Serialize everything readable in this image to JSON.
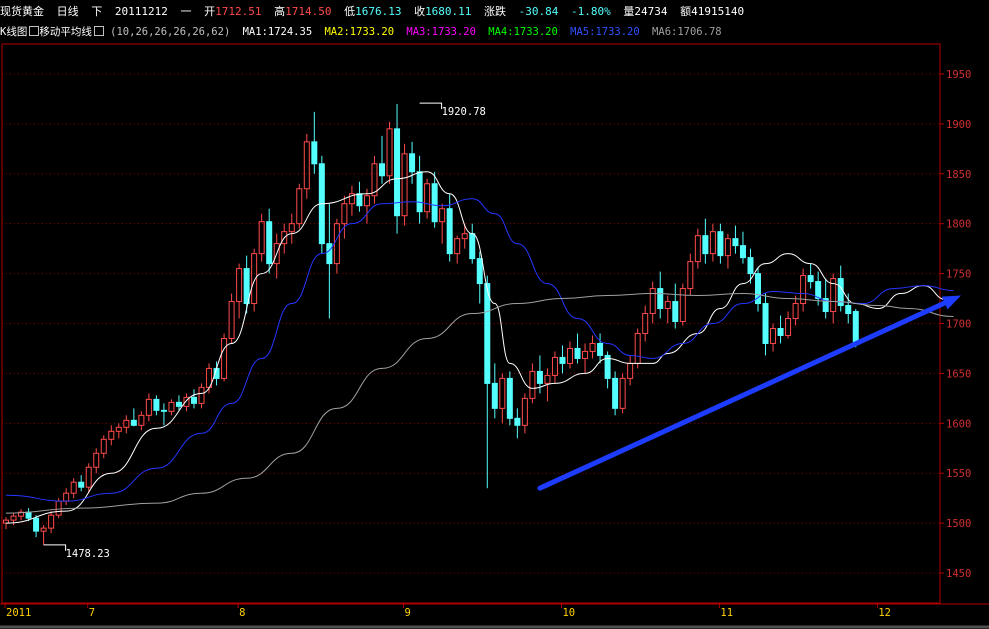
{
  "header": {
    "instrument": "现货黄金",
    "period": "日线",
    "direction": "下",
    "date": "20111212",
    "weekday": "一",
    "open_label": "开",
    "open": "1712.51",
    "high_label": "高",
    "high": "1714.50",
    "low_label": "低",
    "low": "1676.13",
    "close_label": "收",
    "close": "1680.11",
    "change_label": "涨跌",
    "change": "-30.84",
    "change_pct": "-1.80%",
    "volume_label": "量",
    "volume": "24734",
    "amount_label": "额",
    "amount": "41915140"
  },
  "indicator": {
    "kline_label": "K线图",
    "ma_label": "移动平均线",
    "params": "(10,26,26,26,26,62)",
    "ma": [
      {
        "name": "MA1",
        "value": "1724.35",
        "color": "#ffffff"
      },
      {
        "name": "MA2",
        "value": "1733.20",
        "color": "#ffff00"
      },
      {
        "name": "MA3",
        "value": "1733.20",
        "color": "#ff00ff"
      },
      {
        "name": "MA4",
        "value": "1733.20",
        "color": "#00ff00"
      },
      {
        "name": "MA5",
        "value": "1733.20",
        "color": "#3050ff"
      },
      {
        "name": "MA6",
        "value": "1706.78",
        "color": "#a0a0a0"
      }
    ]
  },
  "chart_data": {
    "type": "candlestick",
    "ylim": [
      1420,
      1980
    ],
    "yticks": [
      1450,
      1500,
      1550,
      1600,
      1650,
      1700,
      1750,
      1800,
      1850,
      1900,
      1950
    ],
    "x_labels": [
      {
        "label": "2011",
        "index": 0
      },
      {
        "label": "7",
        "index": 11
      },
      {
        "label": "8",
        "index": 31
      },
      {
        "label": "9",
        "index": 53
      },
      {
        "label": "10",
        "index": 74
      },
      {
        "label": "11",
        "index": 95
      },
      {
        "label": "12",
        "index": 116
      }
    ],
    "annotations": [
      {
        "text": "1920.78",
        "index": 55,
        "value": 1920.78
      },
      {
        "text": "1478.23",
        "index": 5,
        "value": 1478.23
      }
    ],
    "trendline": {
      "from": {
        "index": 71,
        "value": 1535
      },
      "to": {
        "index": 127,
        "value": 1728
      },
      "color": "#1e3cff"
    },
    "up_color": "#ff4a4a",
    "down_color": "#54ffff",
    "candles": [
      [
        1500,
        1506,
        1494,
        1503
      ],
      [
        1503,
        1510,
        1498,
        1507
      ],
      [
        1507,
        1514,
        1503,
        1511
      ],
      [
        1511,
        1515,
        1502,
        1505
      ],
      [
        1505,
        1508,
        1486,
        1492
      ],
      [
        1492,
        1498,
        1478,
        1495
      ],
      [
        1495,
        1512,
        1490,
        1508
      ],
      [
        1508,
        1525,
        1505,
        1522
      ],
      [
        1522,
        1535,
        1518,
        1530
      ],
      [
        1530,
        1545,
        1525,
        1541
      ],
      [
        1541,
        1548,
        1532,
        1536
      ],
      [
        1536,
        1560,
        1530,
        1556
      ],
      [
        1556,
        1575,
        1550,
        1570
      ],
      [
        1570,
        1588,
        1565,
        1584
      ],
      [
        1584,
        1598,
        1578,
        1592
      ],
      [
        1592,
        1600,
        1585,
        1596
      ],
      [
        1596,
        1608,
        1590,
        1603
      ],
      [
        1603,
        1615,
        1597,
        1598
      ],
      [
        1598,
        1612,
        1593,
        1608
      ],
      [
        1608,
        1630,
        1602,
        1624
      ],
      [
        1624,
        1628,
        1608,
        1613
      ],
      [
        1613,
        1620,
        1598,
        1612
      ],
      [
        1612,
        1624,
        1608,
        1621
      ],
      [
        1621,
        1628,
        1613,
        1617
      ],
      [
        1617,
        1630,
        1612,
        1626
      ],
      [
        1626,
        1634,
        1615,
        1620
      ],
      [
        1620,
        1640,
        1615,
        1636
      ],
      [
        1636,
        1660,
        1630,
        1655
      ],
      [
        1655,
        1662,
        1638,
        1645
      ],
      [
        1645,
        1690,
        1642,
        1685
      ],
      [
        1685,
        1730,
        1680,
        1722
      ],
      [
        1722,
        1760,
        1705,
        1755
      ],
      [
        1755,
        1768,
        1710,
        1720
      ],
      [
        1720,
        1775,
        1712,
        1770
      ],
      [
        1770,
        1810,
        1762,
        1802
      ],
      [
        1802,
        1815,
        1750,
        1760
      ],
      [
        1760,
        1790,
        1745,
        1780
      ],
      [
        1780,
        1800,
        1770,
        1792
      ],
      [
        1792,
        1810,
        1780,
        1800
      ],
      [
        1800,
        1840,
        1795,
        1835
      ],
      [
        1835,
        1890,
        1825,
        1882
      ],
      [
        1882,
        1912,
        1850,
        1860
      ],
      [
        1860,
        1868,
        1770,
        1780
      ],
      [
        1780,
        1820,
        1705,
        1760
      ],
      [
        1760,
        1805,
        1750,
        1800
      ],
      [
        1800,
        1828,
        1785,
        1820
      ],
      [
        1820,
        1838,
        1808,
        1830
      ],
      [
        1830,
        1842,
        1812,
        1818
      ],
      [
        1818,
        1835,
        1800,
        1828
      ],
      [
        1828,
        1868,
        1820,
        1860
      ],
      [
        1860,
        1888,
        1840,
        1848
      ],
      [
        1848,
        1902,
        1840,
        1895
      ],
      [
        1895,
        1920,
        1790,
        1808
      ],
      [
        1808,
        1880,
        1798,
        1870
      ],
      [
        1870,
        1882,
        1840,
        1852
      ],
      [
        1852,
        1868,
        1800,
        1812
      ],
      [
        1812,
        1845,
        1805,
        1840
      ],
      [
        1840,
        1852,
        1796,
        1802
      ],
      [
        1802,
        1820,
        1780,
        1815
      ],
      [
        1815,
        1830,
        1762,
        1770
      ],
      [
        1770,
        1788,
        1760,
        1785
      ],
      [
        1785,
        1800,
        1775,
        1790
      ],
      [
        1790,
        1800,
        1760,
        1765
      ],
      [
        1765,
        1772,
        1720,
        1740
      ],
      [
        1740,
        1748,
        1535,
        1640
      ],
      [
        1640,
        1660,
        1605,
        1615
      ],
      [
        1615,
        1650,
        1600,
        1645
      ],
      [
        1645,
        1652,
        1598,
        1605
      ],
      [
        1605,
        1615,
        1585,
        1598
      ],
      [
        1598,
        1630,
        1590,
        1625
      ],
      [
        1625,
        1660,
        1620,
        1652
      ],
      [
        1652,
        1668,
        1630,
        1640
      ],
      [
        1640,
        1655,
        1622,
        1648
      ],
      [
        1648,
        1672,
        1640,
        1666
      ],
      [
        1666,
        1678,
        1650,
        1660
      ],
      [
        1660,
        1682,
        1655,
        1675
      ],
      [
        1675,
        1690,
        1660,
        1665
      ],
      [
        1665,
        1680,
        1650,
        1672
      ],
      [
        1672,
        1688,
        1665,
        1680
      ],
      [
        1680,
        1690,
        1660,
        1668
      ],
      [
        1668,
        1672,
        1635,
        1645
      ],
      [
        1645,
        1652,
        1608,
        1615
      ],
      [
        1615,
        1650,
        1610,
        1645
      ],
      [
        1645,
        1668,
        1638,
        1660
      ],
      [
        1660,
        1695,
        1655,
        1690
      ],
      [
        1690,
        1718,
        1682,
        1710
      ],
      [
        1710,
        1742,
        1700,
        1735
      ],
      [
        1735,
        1752,
        1705,
        1715
      ],
      [
        1715,
        1728,
        1700,
        1722
      ],
      [
        1722,
        1740,
        1695,
        1702
      ],
      [
        1702,
        1740,
        1698,
        1735
      ],
      [
        1735,
        1770,
        1728,
        1762
      ],
      [
        1762,
        1795,
        1755,
        1788
      ],
      [
        1788,
        1805,
        1760,
        1770
      ],
      [
        1770,
        1800,
        1762,
        1792
      ],
      [
        1792,
        1800,
        1760,
        1768
      ],
      [
        1768,
        1790,
        1755,
        1785
      ],
      [
        1785,
        1798,
        1770,
        1778
      ],
      [
        1778,
        1792,
        1760,
        1766
      ],
      [
        1766,
        1775,
        1740,
        1750
      ],
      [
        1750,
        1756,
        1712,
        1720
      ],
      [
        1720,
        1730,
        1668,
        1680
      ],
      [
        1680,
        1700,
        1672,
        1695
      ],
      [
        1695,
        1708,
        1680,
        1688
      ],
      [
        1688,
        1712,
        1685,
        1705
      ],
      [
        1705,
        1728,
        1698,
        1720
      ],
      [
        1720,
        1755,
        1712,
        1748
      ],
      [
        1748,
        1760,
        1735,
        1742
      ],
      [
        1742,
        1752,
        1718,
        1725
      ],
      [
        1725,
        1745,
        1705,
        1712
      ],
      [
        1712,
        1750,
        1700,
        1745
      ],
      [
        1745,
        1758,
        1712,
        1718
      ],
      [
        1718,
        1730,
        1700,
        1710
      ],
      [
        1712,
        1714.5,
        1676.13,
        1680.11
      ]
    ],
    "ma_lines": [
      {
        "name": "MA1",
        "color": "#ffffff",
        "points": [
          [
            0,
            1500
          ],
          [
            8,
            1512
          ],
          [
            14,
            1550
          ],
          [
            20,
            1595
          ],
          [
            26,
            1630
          ],
          [
            30,
            1680
          ],
          [
            34,
            1750
          ],
          [
            38,
            1790
          ],
          [
            42,
            1820
          ],
          [
            48,
            1830
          ],
          [
            52,
            1845
          ],
          [
            56,
            1852
          ],
          [
            59,
            1830
          ],
          [
            62,
            1790
          ],
          [
            65,
            1720
          ],
          [
            67,
            1660
          ],
          [
            70,
            1635
          ],
          [
            73,
            1640
          ],
          [
            77,
            1650
          ],
          [
            80,
            1665
          ],
          [
            83,
            1660
          ],
          [
            86,
            1660
          ],
          [
            88,
            1670
          ],
          [
            92,
            1690
          ],
          [
            95,
            1715
          ],
          [
            98,
            1740
          ],
          [
            101,
            1760
          ],
          [
            104,
            1770
          ],
          [
            107,
            1760
          ],
          [
            110,
            1740
          ],
          [
            113,
            1720
          ],
          [
            116,
            1715
          ],
          [
            119,
            1730
          ],
          [
            122,
            1738
          ],
          [
            125,
            1724
          ]
        ]
      },
      {
        "name": "MA5",
        "color": "#2535ff",
        "points": [
          [
            0,
            1528
          ],
          [
            8,
            1522
          ],
          [
            14,
            1530
          ],
          [
            20,
            1555
          ],
          [
            26,
            1590
          ],
          [
            30,
            1620
          ],
          [
            34,
            1665
          ],
          [
            38,
            1720
          ],
          [
            42,
            1770
          ],
          [
            46,
            1800
          ],
          [
            50,
            1820
          ],
          [
            54,
            1822
          ],
          [
            58,
            1818
          ],
          [
            62,
            1825
          ],
          [
            65,
            1810
          ],
          [
            68,
            1780
          ],
          [
            72,
            1740
          ],
          [
            76,
            1705
          ],
          [
            80,
            1680
          ],
          [
            83,
            1668
          ],
          [
            86,
            1665
          ],
          [
            90,
            1680
          ],
          [
            94,
            1700
          ],
          [
            98,
            1720
          ],
          [
            102,
            1732
          ],
          [
            106,
            1730
          ],
          [
            110,
            1722
          ],
          [
            114,
            1720
          ],
          [
            118,
            1735
          ],
          [
            122,
            1738
          ],
          [
            126,
            1733
          ]
        ]
      },
      {
        "name": "MA6",
        "color": "#a0a0a0",
        "points": [
          [
            0,
            1510
          ],
          [
            10,
            1515
          ],
          [
            20,
            1520
          ],
          [
            26,
            1530
          ],
          [
            32,
            1545
          ],
          [
            38,
            1570
          ],
          [
            44,
            1615
          ],
          [
            50,
            1655
          ],
          [
            56,
            1685
          ],
          [
            62,
            1710
          ],
          [
            68,
            1720
          ],
          [
            74,
            1725
          ],
          [
            80,
            1728
          ],
          [
            86,
            1730
          ],
          [
            92,
            1728
          ],
          [
            98,
            1730
          ],
          [
            104,
            1725
          ],
          [
            110,
            1722
          ],
          [
            116,
            1718
          ],
          [
            120,
            1715
          ],
          [
            126,
            1707
          ]
        ]
      }
    ]
  }
}
